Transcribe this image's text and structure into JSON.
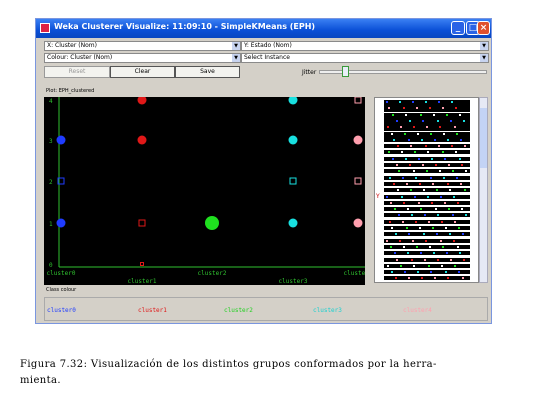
{
  "window": {
    "title": "Weka Clusterer Visualize: 11:09:10 - SimpleKMeans (EPH)",
    "minimize": "_",
    "maximize": "□",
    "close": "×"
  },
  "controls": {
    "x_axis": "X: Cluster (Nom)",
    "y_axis": "Y: Estado (Nom)",
    "colour": "Colour: Cluster (Nom)",
    "select_instance": "Select Instance",
    "reset_label": "Reset",
    "clear_label": "Clear",
    "save_label": "Save",
    "jitter_label": "Jitter",
    "jitter_level": 0.05
  },
  "plot": {
    "title": "Plot: EPH_clustered",
    "y_ticks": [
      "0",
      "1",
      "2",
      "3",
      "4"
    ],
    "x_ticks_upper": [
      "cluster0",
      "cluster2",
      "cluster4"
    ],
    "x_ticks_lower": [
      "cluster1",
      "cluster3"
    ]
  },
  "chart_data": {
    "type": "scatter",
    "title": "Plot: EPH_clustered",
    "categories": [
      "cluster0",
      "cluster1",
      "cluster2",
      "cluster3",
      "cluster4"
    ],
    "y_levels": [
      "0",
      "1",
      "2",
      "3",
      "4"
    ],
    "points": [
      {
        "cluster": "cluster0",
        "y": 1,
        "size": "medium"
      },
      {
        "cluster": "cluster0",
        "y": 2,
        "size": "small"
      },
      {
        "cluster": "cluster0",
        "y": 3,
        "size": "medium"
      },
      {
        "cluster": "cluster1",
        "y": 0,
        "size": "tiny"
      },
      {
        "cluster": "cluster1",
        "y": 1,
        "size": "small"
      },
      {
        "cluster": "cluster1",
        "y": 3,
        "size": "medium"
      },
      {
        "cluster": "cluster1",
        "y": 4,
        "size": "medium"
      },
      {
        "cluster": "cluster2",
        "y": 1,
        "size": "large"
      },
      {
        "cluster": "cluster3",
        "y": 1,
        "size": "medium"
      },
      {
        "cluster": "cluster3",
        "y": 2,
        "size": "small"
      },
      {
        "cluster": "cluster3",
        "y": 3,
        "size": "medium"
      },
      {
        "cluster": "cluster3",
        "y": 4,
        "size": "medium"
      },
      {
        "cluster": "cluster4",
        "y": 1,
        "size": "medium"
      },
      {
        "cluster": "cluster4",
        "y": 2,
        "size": "small"
      },
      {
        "cluster": "cluster4",
        "y": 3,
        "size": "medium"
      },
      {
        "cluster": "cluster4",
        "y": 4,
        "size": "small"
      }
    ],
    "colors": {
      "cluster0": "#1f3cff",
      "cluster1": "#e01818",
      "cluster2": "#1fe01f",
      "cluster3": "#18e0e0",
      "cluster4": "#ff9fae"
    }
  },
  "legend": {
    "title": "Class colour",
    "items": [
      {
        "label": "cluster0",
        "color": "#1f3cff"
      },
      {
        "label": "cluster1",
        "color": "#e01818"
      },
      {
        "label": "cluster2",
        "color": "#1fd01f"
      },
      {
        "label": "cluster3",
        "color": "#18d0d0"
      },
      {
        "label": "cluster4",
        "color": "#ff9fae"
      }
    ]
  },
  "matrix": {
    "y_marker": "Y"
  },
  "caption": "Figura  7.32:  Visualización  de  los  distintos  grupos  conformados  por  la  herra-\nmienta."
}
